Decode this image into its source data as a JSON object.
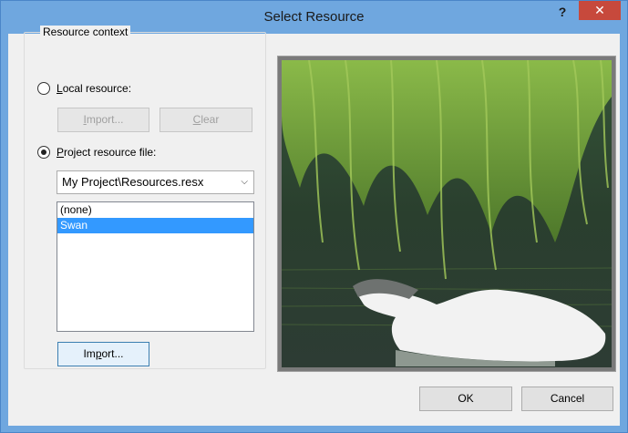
{
  "window": {
    "title": "Select Resource"
  },
  "titlebar": {
    "help_glyph": "?",
    "close_glyph": "✕"
  },
  "context": {
    "legend": "Resource context",
    "local_label_key": "L",
    "local_label_rest": "ocal resource:",
    "local_selected": false,
    "import_disabled": {
      "key": "I",
      "pre": "",
      "rest": "mport..."
    },
    "clear": {
      "pre": "",
      "key": "C",
      "rest": "lear"
    },
    "project_label_key": "P",
    "project_label_rest": "roject resource file:",
    "project_selected": true,
    "project_file": "My Project\\Resources.resx",
    "resources": [
      {
        "label": "(none)",
        "selected": false
      },
      {
        "label": "Swan",
        "selected": true
      }
    ],
    "import_button": {
      "pre": "Im",
      "key": "p",
      "rest": "ort..."
    }
  },
  "footer": {
    "ok_label": "OK",
    "cancel_label": "Cancel"
  },
  "icons": {
    "chevron": "chevron-down-icon",
    "close": "close-icon",
    "help": "help-icon"
  },
  "colors": {
    "titlebar": "#6fa7df",
    "close": "#c7493c",
    "selection": "#3399ff"
  }
}
